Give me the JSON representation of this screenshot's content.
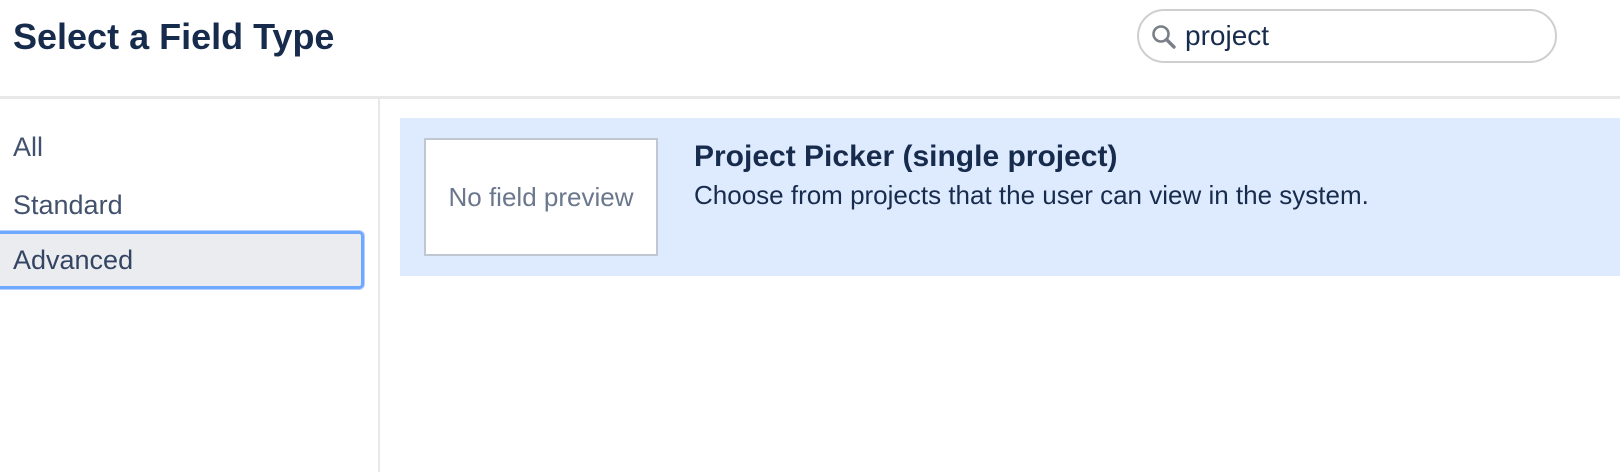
{
  "header": {
    "title": "Select a Field Type"
  },
  "search": {
    "value": "project",
    "icon": "search-icon"
  },
  "sidebar": {
    "items": [
      {
        "label": "All",
        "selected": false
      },
      {
        "label": "Standard",
        "selected": false
      },
      {
        "label": "Advanced",
        "selected": true
      }
    ]
  },
  "results": [
    {
      "preview_text": "No field preview",
      "title": "Project Picker (single project)",
      "description": "Choose from projects that the user can view in the system.",
      "selected": true
    }
  ],
  "colors": {
    "title_text": "#172b4d",
    "selected_row_bg": "#deebff",
    "selected_nav_bg": "#ebecf0",
    "focus_ring": "#6fa8ff"
  }
}
